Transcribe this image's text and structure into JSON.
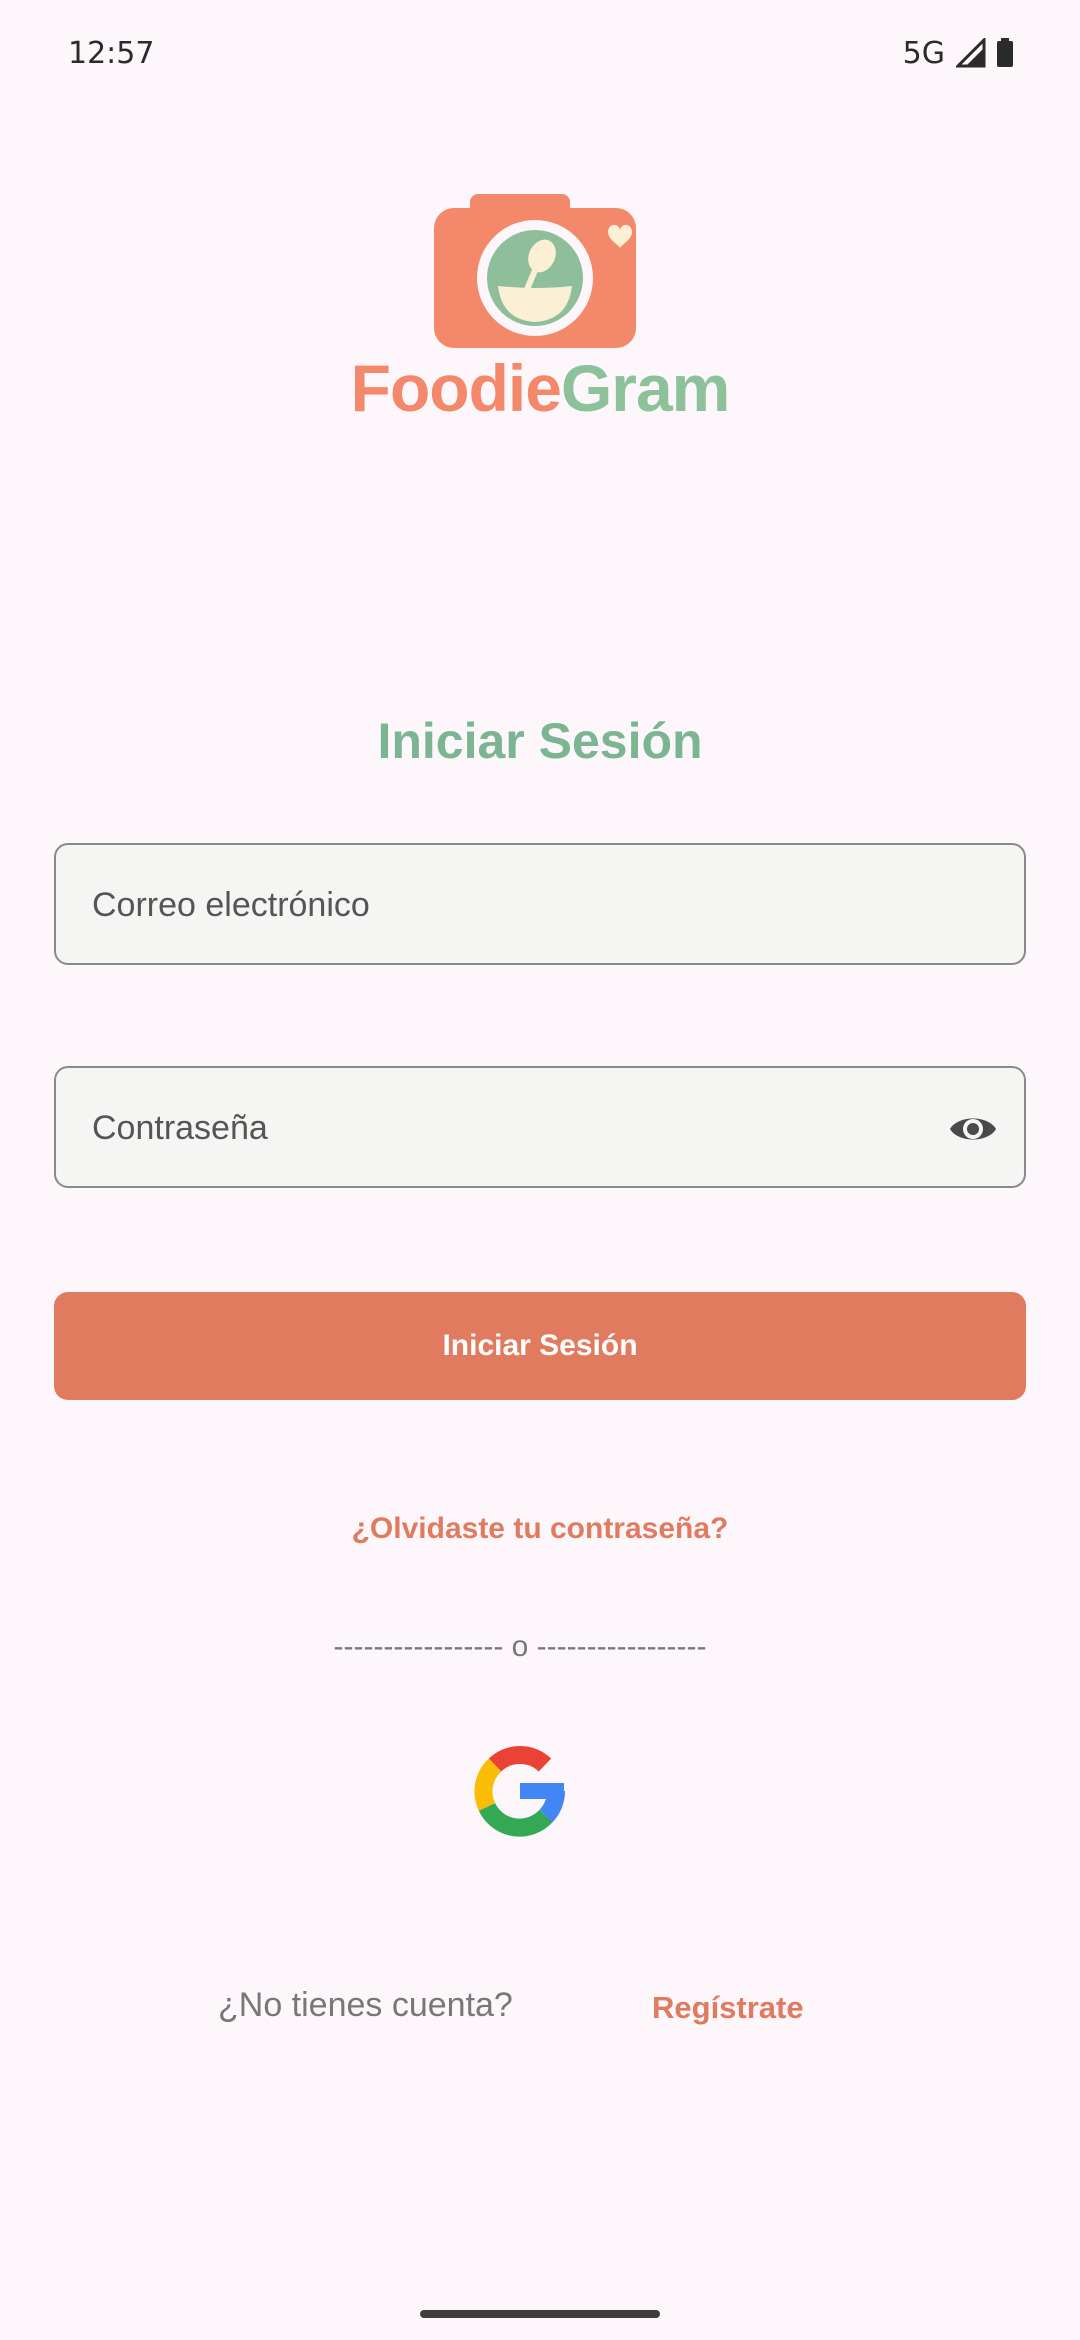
{
  "status_bar": {
    "time": "12:57",
    "network": "5G"
  },
  "brand": {
    "part1": "Foodie",
    "part2": "Gram"
  },
  "login": {
    "title": "Iniciar Sesión",
    "email_placeholder": "Correo electrónico",
    "password_placeholder": "Contraseña",
    "submit_label": "Iniciar Sesión",
    "forgot_label": "¿Olvidaste tu contraseña?",
    "divider": "----------------- o -----------------",
    "google_icon": "google-logo"
  },
  "signup": {
    "prompt": "¿No tienes cuenta?",
    "link": "Regístrate"
  },
  "colors": {
    "background": "#fdf7fc",
    "accent_orange": "#e07b60",
    "accent_green": "#7cb592",
    "field_bg": "#f5f5f3"
  }
}
